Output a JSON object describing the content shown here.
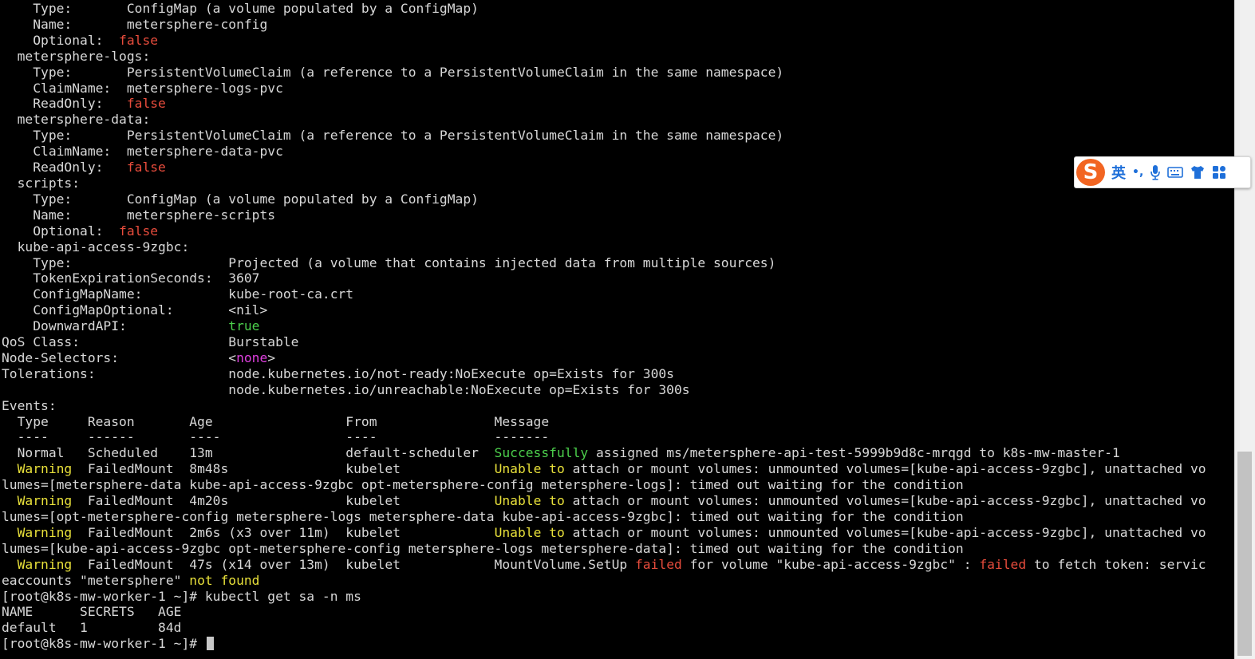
{
  "terminal": {
    "lines": [
      [
        {
          "t": "    Type:       ConfigMap (a volume populated by a ConfigMap)"
        }
      ],
      [
        {
          "t": "    Name:       metersphere-config"
        }
      ],
      [
        {
          "t": "    Optional:  "
        },
        {
          "t": "false",
          "c": "red"
        }
      ],
      [
        {
          "t": "  metersphere-logs:"
        }
      ],
      [
        {
          "t": "    Type:       PersistentVolumeClaim (a reference to a PersistentVolumeClaim in the same namespace)"
        }
      ],
      [
        {
          "t": "    ClaimName:  metersphere-logs-pvc"
        }
      ],
      [
        {
          "t": "    ReadOnly:   "
        },
        {
          "t": "false",
          "c": "red"
        }
      ],
      [
        {
          "t": "  metersphere-data:"
        }
      ],
      [
        {
          "t": "    Type:       PersistentVolumeClaim (a reference to a PersistentVolumeClaim in the same namespace)"
        }
      ],
      [
        {
          "t": "    ClaimName:  metersphere-data-pvc"
        }
      ],
      [
        {
          "t": "    ReadOnly:   "
        },
        {
          "t": "false",
          "c": "red"
        }
      ],
      [
        {
          "t": "  scripts:"
        }
      ],
      [
        {
          "t": "    Type:       ConfigMap (a volume populated by a ConfigMap)"
        }
      ],
      [
        {
          "t": "    Name:       metersphere-scripts"
        }
      ],
      [
        {
          "t": "    Optional:  "
        },
        {
          "t": "false",
          "c": "red"
        }
      ],
      [
        {
          "t": "  kube-api-access-9zgbc:"
        }
      ],
      [
        {
          "t": "    Type:                    Projected (a volume that contains injected data from multiple sources)"
        }
      ],
      [
        {
          "t": "    TokenExpirationSeconds:  3607"
        }
      ],
      [
        {
          "t": "    ConfigMapName:           kube-root-ca.crt"
        }
      ],
      [
        {
          "t": "    ConfigMapOptional:       <nil>"
        }
      ],
      [
        {
          "t": "    DownwardAPI:             "
        },
        {
          "t": "true",
          "c": "green"
        }
      ],
      [
        {
          "t": "QoS Class:                   Burstable"
        }
      ],
      [
        {
          "t": "Node-Selectors:              <"
        },
        {
          "t": "none",
          "c": "magenta"
        },
        {
          "t": ">"
        }
      ],
      [
        {
          "t": "Tolerations:                 node.kubernetes.io/not-ready:NoExecute op=Exists for 300s"
        }
      ],
      [
        {
          "t": "                             node.kubernetes.io/unreachable:NoExecute op=Exists for 300s"
        }
      ],
      [
        {
          "t": "Events:"
        }
      ],
      [
        {
          "t": "  Type     Reason       Age                 From               Message"
        }
      ],
      [
        {
          "t": "  ----     ------       ----                ----               -------"
        }
      ],
      [
        {
          "t": "  Normal   Scheduled    13m                 default-scheduler  "
        },
        {
          "t": "Successfully",
          "c": "green"
        },
        {
          "t": " assigned ms/metersphere-api-test-5999b9d8c-mrqgd to k8s-mw-master-1"
        }
      ],
      [
        {
          "t": "  "
        },
        {
          "t": "Warning",
          "c": "yellow"
        },
        {
          "t": "  FailedMount  8m48s               kubelet            "
        },
        {
          "t": "Unable to",
          "c": "yellow"
        },
        {
          "t": " attach or mount volumes: unmounted volumes=[kube-api-access-9zgbc], unattached vo"
        }
      ],
      [
        {
          "t": "lumes=[metersphere-data kube-api-access-9zgbc opt-metersphere-config metersphere-logs]: timed out waiting for the condition"
        }
      ],
      [
        {
          "t": "  "
        },
        {
          "t": "Warning",
          "c": "yellow"
        },
        {
          "t": "  FailedMount  4m20s               kubelet            "
        },
        {
          "t": "Unable to",
          "c": "yellow"
        },
        {
          "t": " attach or mount volumes: unmounted volumes=[kube-api-access-9zgbc], unattached vo"
        }
      ],
      [
        {
          "t": "lumes=[opt-metersphere-config metersphere-logs metersphere-data kube-api-access-9zgbc]: timed out waiting for the condition"
        }
      ],
      [
        {
          "t": "  "
        },
        {
          "t": "Warning",
          "c": "yellow"
        },
        {
          "t": "  FailedMount  2m6s (x3 over 11m)  kubelet            "
        },
        {
          "t": "Unable to",
          "c": "yellow"
        },
        {
          "t": " attach or mount volumes: unmounted volumes=[kube-api-access-9zgbc], unattached vo"
        }
      ],
      [
        {
          "t": "lumes=[kube-api-access-9zgbc opt-metersphere-config metersphere-logs metersphere-data]: timed out waiting for the condition"
        }
      ],
      [
        {
          "t": "  "
        },
        {
          "t": "Warning",
          "c": "yellow"
        },
        {
          "t": "  FailedMount  47s (x14 over 13m)  kubelet            MountVolume.SetUp "
        },
        {
          "t": "failed",
          "c": "red"
        },
        {
          "t": " for volume \"kube-api-access-9zgbc\" : "
        },
        {
          "t": "failed",
          "c": "red"
        },
        {
          "t": " to fetch token: servic"
        }
      ],
      [
        {
          "t": "eaccounts \"metersphere\" "
        },
        {
          "t": "not found",
          "c": "yellow"
        }
      ],
      [
        {
          "t": "[root@k8s-mw-worker-1 ~]# kubectl get sa -n ms"
        }
      ],
      [
        {
          "t": "NAME      SECRETS   AGE"
        }
      ],
      [
        {
          "t": "default   1         84d"
        }
      ],
      [
        {
          "t": "[root@k8s-mw-worker-1 ~]# "
        },
        {
          "cursor": true
        }
      ]
    ]
  },
  "colors": {
    "background": "#000000",
    "foreground": "#d8d8d8",
    "red": "#e74c3c",
    "yellow": "#e8e03a",
    "green": "#4cd04c",
    "magenta": "#e040e0"
  },
  "ime_toolbar": {
    "logo": "S",
    "language": "英",
    "punctuation": "•,",
    "icons": [
      "microphone-icon",
      "keyboard-icon",
      "skin-icon",
      "toolbox-icon"
    ]
  }
}
